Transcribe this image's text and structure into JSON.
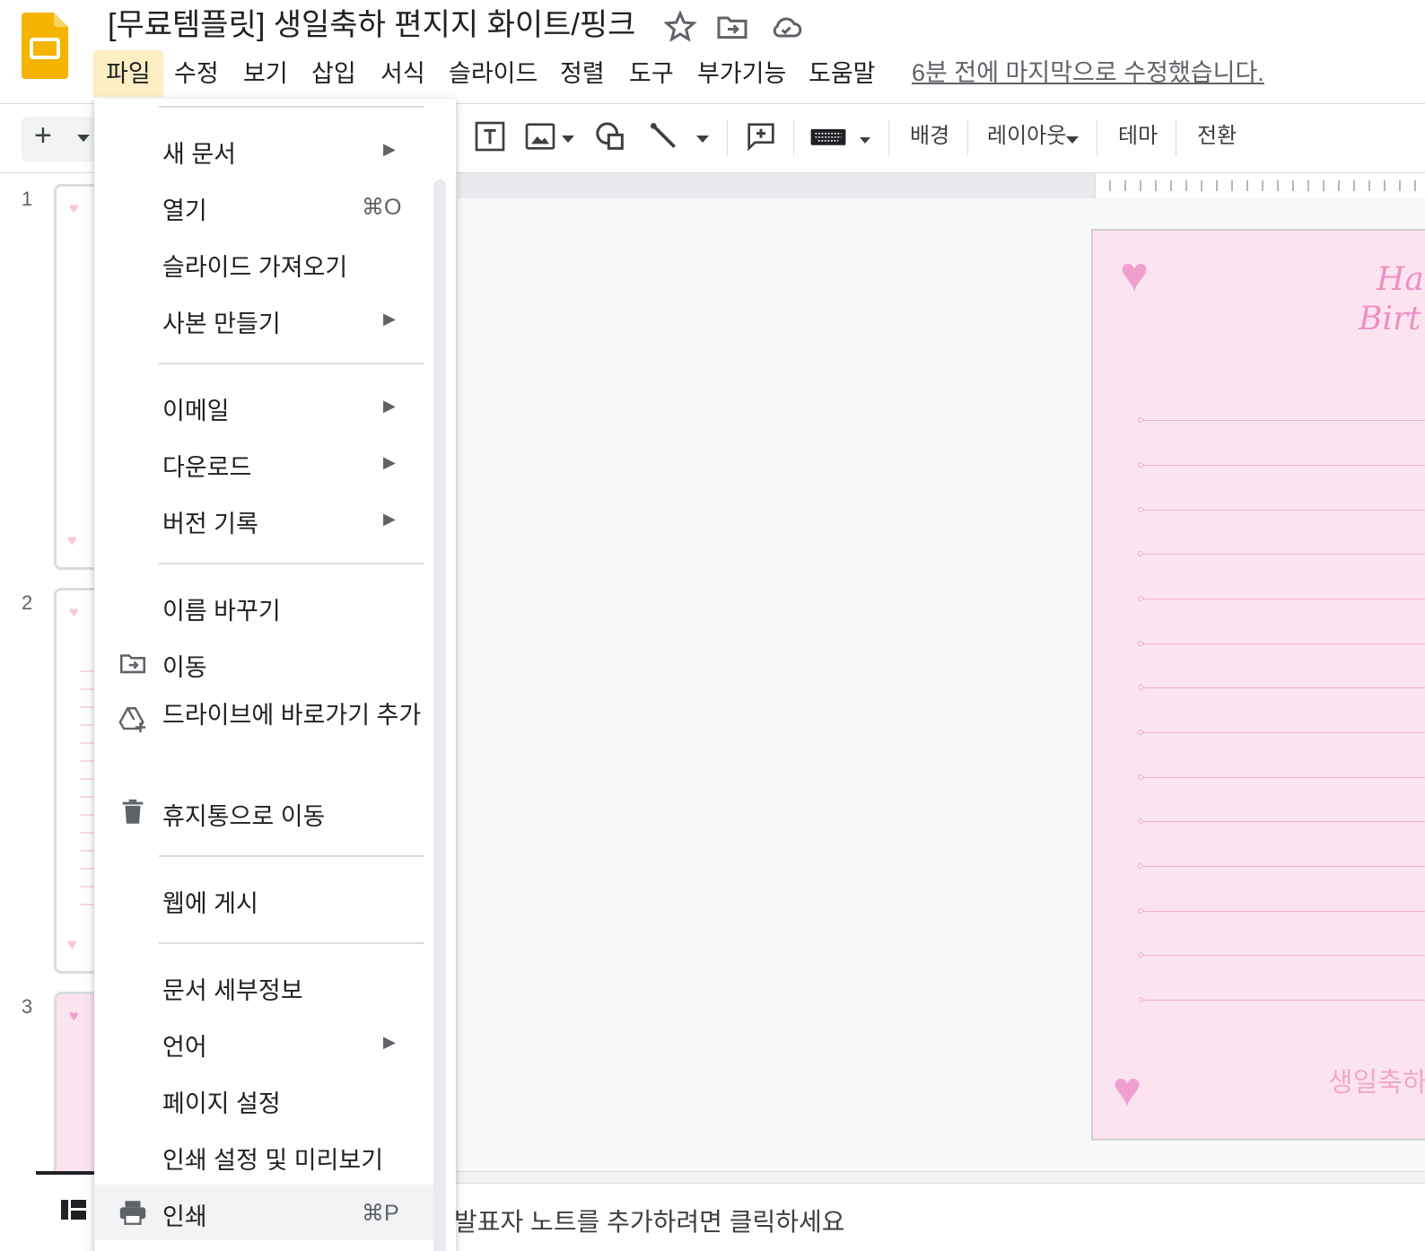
{
  "header": {
    "title": "[무료템플릿] 생일축하 편지지 화이트/핑크",
    "star_icon": "star-icon",
    "move_icon": "folder-move-icon",
    "cloud_icon": "cloud-saved-icon"
  },
  "menubar": {
    "items": [
      "파일",
      "수정",
      "보기",
      "삽입",
      "서식",
      "슬라이드",
      "정렬",
      "도구",
      "부가기능",
      "도움말"
    ],
    "active": "파일",
    "last_edit": "6분 전에 마지막으로 수정했습니다."
  },
  "toolbar": {
    "add_icon": "+",
    "background": "배경",
    "layout": "레이아웃",
    "theme": "테마",
    "transition": "전환"
  },
  "filmstrip": {
    "slide_numbers": [
      "1",
      "2",
      "3"
    ]
  },
  "file_menu": {
    "items": [
      {
        "label": "새 문서",
        "submenu": true
      },
      {
        "label": "열기",
        "shortcut": "⌘O"
      },
      {
        "label": "슬라이드 가져오기"
      },
      {
        "label": "사본 만들기",
        "submenu": true
      },
      {
        "label": "이메일",
        "submenu": true
      },
      {
        "label": "다운로드",
        "submenu": true
      },
      {
        "label": "버전 기록",
        "submenu": true
      },
      {
        "label": "이름 바꾸기"
      },
      {
        "label": "이동",
        "icon": "folder-move-icon"
      },
      {
        "label": "드라이브에 바로가기 추가",
        "icon": "drive-shortcut-icon"
      },
      {
        "label": "휴지통으로 이동",
        "icon": "trash-icon"
      },
      {
        "label": "웹에 게시"
      },
      {
        "label": "문서 세부정보"
      },
      {
        "label": "언어",
        "submenu": true
      },
      {
        "label": "페이지 설정"
      },
      {
        "label": "인쇄 설정 및 미리보기"
      },
      {
        "label": "인쇄",
        "shortcut": "⌘P",
        "icon": "print-icon"
      }
    ],
    "submenu_arrow": "▶"
  },
  "slide": {
    "script_line1": "Ha",
    "script_line2": "Birt",
    "footer_text": "생일축하",
    "accent_color": "#f0a0cf",
    "background_color": "#fbe4ef"
  },
  "notes": {
    "placeholder": "발표자 노트를 추가하려면 클릭하세요"
  },
  "colors": {
    "logo": "#f4b400",
    "active_menu": "#fdefc3"
  }
}
